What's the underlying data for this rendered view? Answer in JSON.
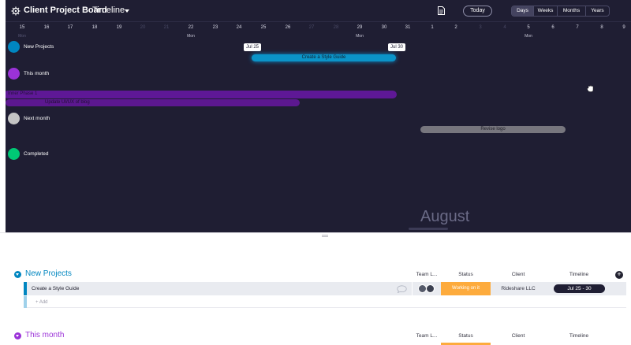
{
  "header": {
    "title": "Client Project Board",
    "view_name": "Timeline",
    "today_label": "Today",
    "zoom_options": [
      "Days",
      "Weeks",
      "Months",
      "Years"
    ],
    "active_zoom": "Days"
  },
  "dates": [
    {
      "label": "15",
      "weekday": "Mon",
      "weekend": false
    },
    {
      "label": "16",
      "weekday": "",
      "weekend": false
    },
    {
      "label": "17",
      "weekday": "",
      "weekend": false
    },
    {
      "label": "18",
      "weekday": "",
      "weekend": false
    },
    {
      "label": "19",
      "weekday": "",
      "weekend": false
    },
    {
      "label": "20",
      "weekday": "",
      "weekend": true
    },
    {
      "label": "21",
      "weekday": "",
      "weekend": true
    },
    {
      "label": "22",
      "weekday": "Mon",
      "weekend": false
    },
    {
      "label": "23",
      "weekday": "",
      "weekend": false
    },
    {
      "label": "24",
      "weekday": "",
      "weekend": false
    },
    {
      "label": "25",
      "weekday": "",
      "weekend": false
    },
    {
      "label": "26",
      "weekday": "",
      "weekend": false
    },
    {
      "label": "27",
      "weekday": "",
      "weekend": true
    },
    {
      "label": "28",
      "weekday": "",
      "weekend": true
    },
    {
      "label": "29",
      "weekday": "Mon",
      "weekend": false
    },
    {
      "label": "30",
      "weekday": "",
      "weekend": false
    },
    {
      "label": "31",
      "weekday": "",
      "weekend": false
    },
    {
      "label": "1",
      "weekday": "",
      "weekend": false
    },
    {
      "label": "2",
      "weekday": "",
      "weekend": false
    },
    {
      "label": "3",
      "weekday": "",
      "weekend": true
    },
    {
      "label": "4",
      "weekday": "",
      "weekend": true
    },
    {
      "label": "5",
      "weekday": "Mon",
      "weekend": false
    },
    {
      "label": "6",
      "weekday": "",
      "weekend": false
    },
    {
      "label": "7",
      "weekday": "",
      "weekend": false
    },
    {
      "label": "8",
      "weekday": "",
      "weekend": false
    },
    {
      "label": "9",
      "weekday": "",
      "weekend": false
    }
  ],
  "groups": [
    {
      "name": "New Projects",
      "color": "#0086c0"
    },
    {
      "name": "This month",
      "color": "#9b32d8"
    },
    {
      "name": "Next month",
      "color": "#c4c4c4"
    },
    {
      "name": "Completed",
      "color": "#00c875"
    }
  ],
  "timeline_bars": {
    "style_guide": {
      "label": "Create a Style Guide",
      "start_tip": "Jul 25",
      "end_tip": "Jul 30"
    },
    "phase": {
      "label": "Inner Phase 1"
    },
    "update_ux": {
      "label": "Update UI/UX of blog"
    },
    "revise_logo": {
      "label": "Revise logo"
    }
  },
  "month_watermark": "August",
  "board": {
    "group1": {
      "title": "New Projects",
      "color": "#0086c0",
      "columns": {
        "team": "Team L...",
        "status": "Status",
        "client": "Client",
        "timeline": "Timeline"
      },
      "item": {
        "name": "Create a Style Guide",
        "status": "Working on it",
        "status_color": "#fdab3d",
        "client": "Rideshare LLC",
        "timeline": "Jul 25 - 30"
      },
      "add_label": "+ Add"
    },
    "group2": {
      "title": "This month",
      "color": "#9b32d8",
      "columns": {
        "team": "Team L...",
        "status": "Status",
        "client": "Client",
        "timeline": "Timeline"
      }
    }
  }
}
